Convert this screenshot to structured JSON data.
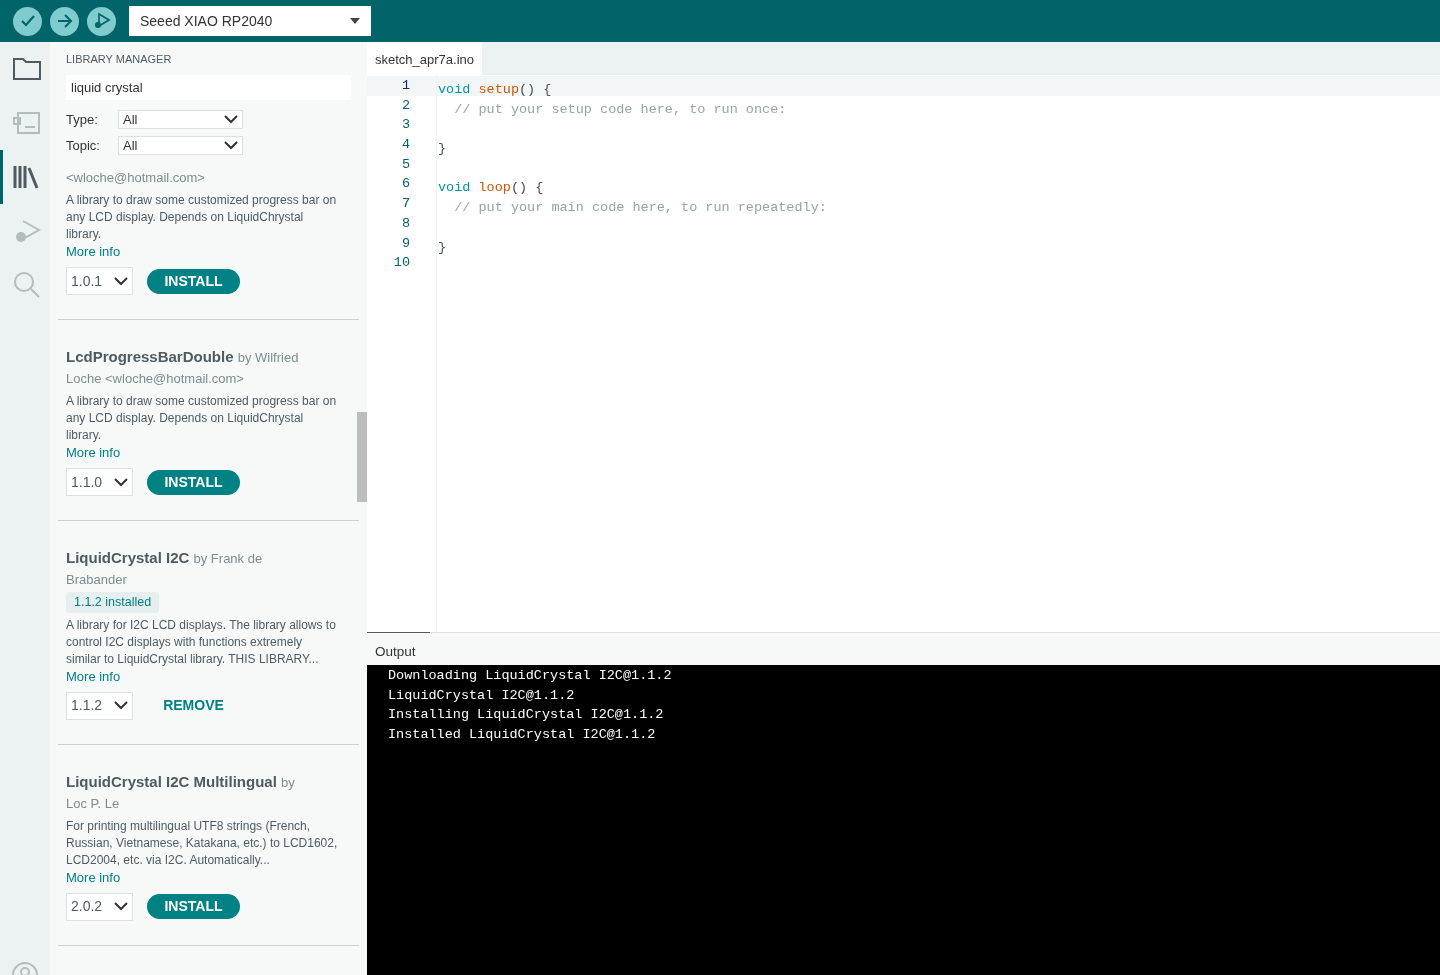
{
  "toolbar": {
    "buttons": [
      {
        "kind": "verify"
      },
      {
        "kind": "upload"
      },
      {
        "kind": "debug"
      }
    ],
    "board": "Seeed XIAO RP2040"
  },
  "sidebar": {
    "items": [
      {
        "kind": "folder",
        "selected": false
      },
      {
        "kind": "board",
        "selected": false
      },
      {
        "kind": "library",
        "selected": true
      },
      {
        "kind": "debug",
        "selected": false
      },
      {
        "kind": "search",
        "selected": false
      }
    ],
    "bottom": [
      {
        "kind": "account"
      }
    ]
  },
  "library_manager": {
    "title": "LIBRARY MANAGER",
    "search": {
      "value": "liquid crystal"
    },
    "filters": [
      {
        "label": "Type:",
        "value": "All"
      },
      {
        "label": "Topic:",
        "value": "All"
      }
    ],
    "libraries": [
      {
        "byline": "<wloche@hotmail.com>",
        "description": "A library to draw some customized progress bar on any LCD display. Depends on LiquidChrystal library.",
        "more_info": "More info",
        "version": "1.0.1",
        "action": {
          "kind": "install",
          "label": "INSTALL"
        }
      },
      {
        "name": "LcdProgressBarDouble",
        "byline": "by Wilfried Loche <wloche@hotmail.com>",
        "description": "A library to draw some customized progress bar on any LCD display. Depends on LiquidChrystal library.",
        "more_info": "More info",
        "version": "1.1.0",
        "action": {
          "kind": "install",
          "label": "INSTALL"
        }
      },
      {
        "name": "LiquidCrystal I2C",
        "byline": "by Frank de Brabander",
        "badge": "1.1.2 installed",
        "description": "A library for I2C LCD displays. The library allows to control I2C displays with functions extremely similar to LiquidCrystal library. THIS LIBRARY...",
        "more_info": "More info",
        "version": "1.1.2",
        "action": {
          "kind": "remove",
          "label": "REMOVE"
        }
      },
      {
        "name": "LiquidCrystal I2C Multilingual",
        "byline": "by Loc P. Le",
        "description": "For printing multilingual UTF8 strings (French, Russian, Vietnamese, Katakana, etc.) to LCD1602, LCD2004, etc. via I2C. Automatically...",
        "more_info": "More info",
        "version": "2.0.2",
        "action": {
          "kind": "install",
          "label": "INSTALL"
        }
      }
    ]
  },
  "editor": {
    "tabs": [
      {
        "label": "sketch_apr7a.ino",
        "selected": true
      }
    ],
    "lines": [
      {
        "number": "1",
        "current": true,
        "tokens": [
          {
            "kind": "keyword",
            "text": "void"
          },
          {
            "kind": "function",
            "text": "setup"
          },
          {
            "kind": "plain",
            "text": "() {"
          }
        ]
      },
      {
        "number": "2",
        "current": false,
        "tokens": [
          {
            "kind": "comment",
            "text": "  // put your setup code here, to run once:"
          }
        ]
      },
      {
        "number": "3",
        "current": false
      },
      {
        "number": "4",
        "current": false,
        "tokens": [
          {
            "kind": "plain",
            "text": "}"
          }
        ]
      },
      {
        "number": "5",
        "current": false
      },
      {
        "number": "6",
        "current": false,
        "tokens": [
          {
            "kind": "keyword",
            "text": "void"
          },
          {
            "kind": "function",
            "text": "loop"
          },
          {
            "kind": "plain",
            "text": "() {"
          }
        ]
      },
      {
        "number": "7",
        "current": false,
        "tokens": [
          {
            "kind": "comment",
            "text": "  // put your main code here, to run repeatedly:"
          }
        ]
      },
      {
        "number": "8",
        "current": false
      },
      {
        "number": "9",
        "current": false,
        "tokens": [
          {
            "kind": "plain",
            "text": "}"
          }
        ]
      },
      {
        "number": "10",
        "current": false
      }
    ]
  },
  "output": {
    "title": "Output",
    "lines": [
      "Downloading LiquidCrystal I2C@1.1.2",
      "LiquidCrystal I2C@1.1.2",
      "Installing LiquidCrystal I2C@1.1.2",
      "Installed LiquidCrystal I2C@1.1.2"
    ]
  }
}
